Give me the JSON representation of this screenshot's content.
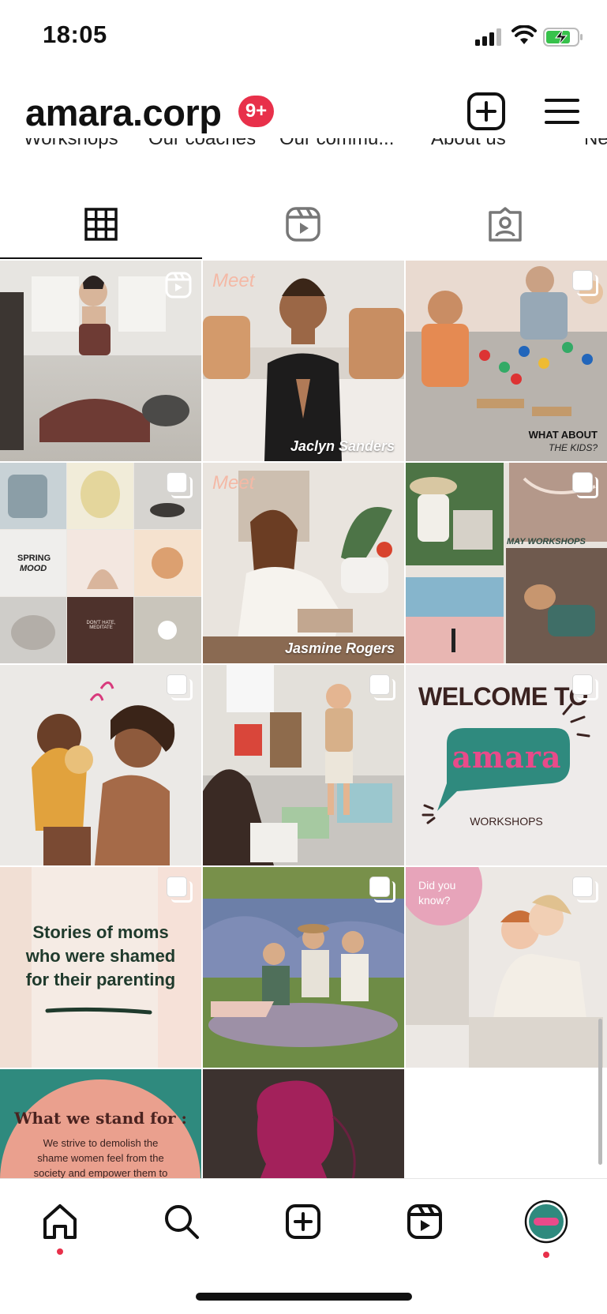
{
  "status": {
    "time": "18:05"
  },
  "header": {
    "username": "amara.corp",
    "notification_badge": "9+"
  },
  "highlights": [
    "Workshops",
    "Our coaches",
    "Our commu...",
    "About us",
    "Ne"
  ],
  "tabs": [
    {
      "name": "grid",
      "icon": "grid-icon",
      "active": true
    },
    {
      "name": "reels",
      "icon": "reels-icon",
      "active": false
    },
    {
      "name": "tagged",
      "icon": "tagged-icon",
      "active": false
    }
  ],
  "posts": {
    "p2_meet": "Meet",
    "p2_name": "Jaclyn Sanders",
    "p3_title": "WHAT ABOUT",
    "p3_sub": "THE KIDS?",
    "p4_spring": "SPRING",
    "p4_mood": "MOOD",
    "p4_dont": "DON'T HATE, MEDITATE",
    "p5_meet": "Meet",
    "p5_name": "Jasmine Rogers",
    "p6_label": "MAY WORKSHOPS",
    "p9_welcome": "WELCOME TO",
    "p9_logo": "amara",
    "p9_workshops": "WORKSHOPS",
    "p10_text": "Stories of moms who were shamed for their parenting",
    "p12_bubble": "Did you know?",
    "p13_title": "What we stand for :",
    "p13_text": "We strive to demolish the shame women feel from the society and empower them to be their"
  },
  "colors": {
    "accent_red": "#e8304a",
    "teal": "#2f8a7e",
    "pink": "#e94a8a"
  }
}
